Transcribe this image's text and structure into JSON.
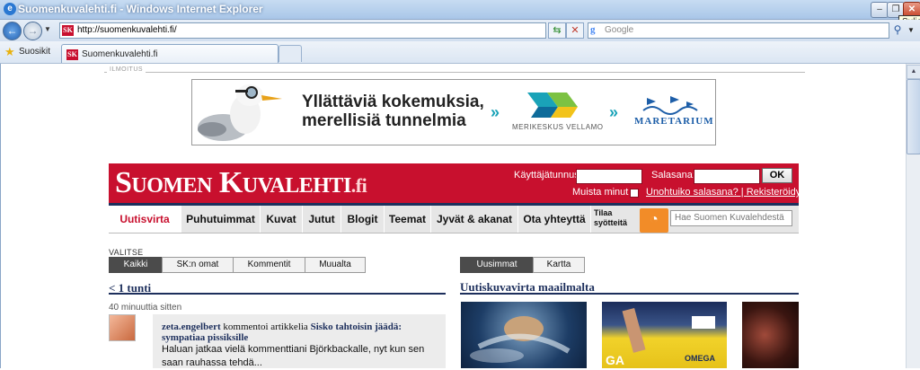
{
  "window": {
    "title": "Suomenkuvalehti.fi - Windows Internet Explorer",
    "close_tooltip": "Sulje"
  },
  "browser": {
    "url": "http://suomenkuvalehti.fi/",
    "search_placeholder": "Google",
    "favorites_label": "Suosikit",
    "tab_title": "Suomenkuvalehti.fi",
    "favicon_text": "SK"
  },
  "ad": {
    "label": "ILMOITUS",
    "headline_line1": "Yllättäviä kokemuksia,",
    "headline_line2": "merellisiä tunnelmia",
    "museum1": "MERIKESKUS VELLAMO",
    "museum2": "MARETARIUM",
    "arrow": "»"
  },
  "header": {
    "logo_main": "Suomen Kuvalehti",
    "logo_suffix": ".fi",
    "username_label": "Käyttäjätunnus:",
    "password_label": "Salasana:",
    "ok_label": "OK",
    "remember_label": "Muista minut",
    "forgot_link": "Unohtuiko salasana? | Rekisteröidy."
  },
  "nav": {
    "items": [
      "Uutisvirta",
      "Puhutuimmat",
      "Kuvat",
      "Jutut",
      "Blogit",
      "Teemat",
      "Jyvät & akanat",
      "Ota yhteyttä"
    ],
    "subscribe_line1": "Tilaa",
    "subscribe_line2": "syötteitä",
    "search_placeholder": "Hae Suomen Kuvalehdestä"
  },
  "left": {
    "choose_label": "VALITSE",
    "filters": [
      "Kaikki",
      "SK:n omat",
      "Kommentit",
      "Muualta"
    ],
    "heading": "< 1 tunti",
    "time_ago": "40 minuuttia sitten",
    "feed": {
      "user": "zeta.engelbert",
      "action": " kommentoi artikkelia ",
      "article": "Sisko tahtoisin jäädä: sympatiaa pissiksille",
      "excerpt": "Haluan jatkaa vielä kommenttiani Björkbackalle, nyt kun sen saan rauhassa tehdä..."
    }
  },
  "right": {
    "tabs": [
      "Uusimmat",
      "Kartta"
    ],
    "heading": "Uutiskuvavirta maailmalta"
  },
  "colors": {
    "brand_red": "#c8102e",
    "brand_navy": "#1d2f5c",
    "rss_orange": "#f28c28"
  }
}
